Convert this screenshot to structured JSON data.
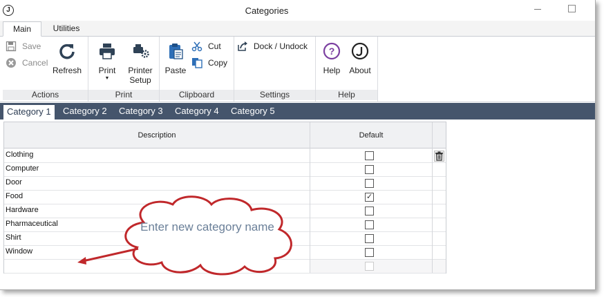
{
  "window": {
    "title": "Categories",
    "logo_letter": "J"
  },
  "ribbon_tabs": [
    {
      "label": "Main",
      "active": true
    },
    {
      "label": "Utilities",
      "active": false
    }
  ],
  "ribbon": {
    "actions": {
      "save": "Save",
      "cancel": "Cancel",
      "refresh": "Refresh",
      "group": "Actions"
    },
    "print": {
      "print": "Print",
      "printer": "Printer",
      "setup": "Setup",
      "group": "Print"
    },
    "clipboard": {
      "paste": "Paste",
      "cut": "Cut",
      "copy": "Copy",
      "group": "Clipboard"
    },
    "settings": {
      "dock": "Dock / Undock",
      "group": "Settings"
    },
    "help": {
      "help": "Help",
      "about": "About",
      "group": "Help"
    }
  },
  "category_tabs": [
    {
      "label": "Category 1",
      "active": true
    },
    {
      "label": "Category 2",
      "active": false
    },
    {
      "label": "Category 3",
      "active": false
    },
    {
      "label": "Category 4",
      "active": false
    },
    {
      "label": "Category 5",
      "active": false
    }
  ],
  "grid": {
    "columns": {
      "description": "Description",
      "default": "Default"
    },
    "rows": [
      {
        "description": "Clothing",
        "default": false
      },
      {
        "description": "Computer",
        "default": false
      },
      {
        "description": "Door",
        "default": false
      },
      {
        "description": "Food",
        "default": true
      },
      {
        "description": "Hardware",
        "default": false
      },
      {
        "description": "Pharmaceutical",
        "default": false
      },
      {
        "description": "Shirt",
        "default": false
      },
      {
        "description": "Window",
        "default": false
      }
    ]
  },
  "callout": {
    "text": "Enter new category name"
  },
  "colors": {
    "tab_bar": "#45556c",
    "accent_purple": "#7b3fa0",
    "accent_blue": "#2e6fb7",
    "callout_text": "#6a7f98",
    "arrow": "#c0282b"
  }
}
